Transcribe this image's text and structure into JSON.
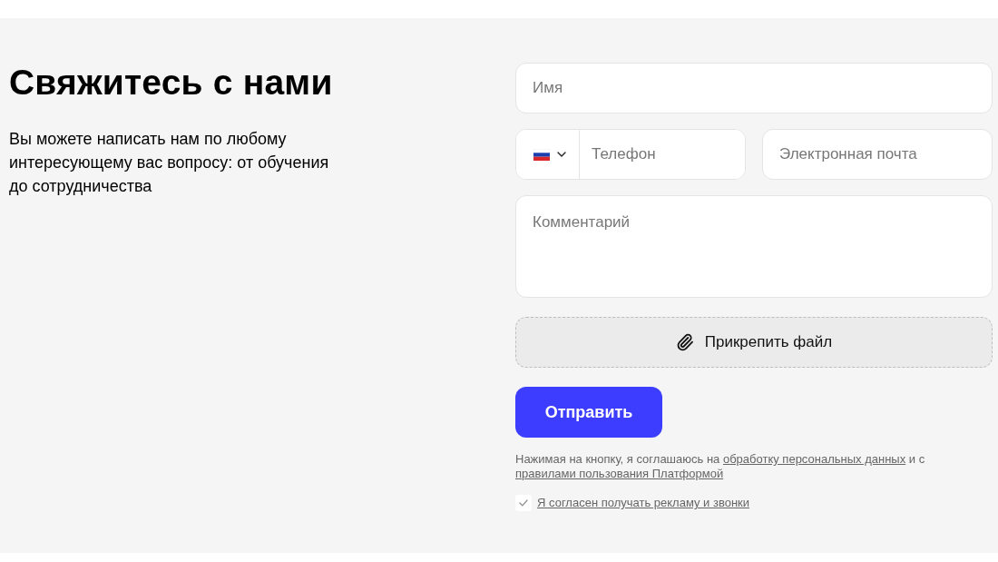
{
  "heading": {
    "title": "Свяжитесь с нами",
    "description": "Вы можете написать нам по любому интересующему вас вопросу: от обучения до сотрудничества"
  },
  "form": {
    "name": {
      "placeholder": "Имя"
    },
    "phone": {
      "placeholder": "Телефон"
    },
    "email": {
      "placeholder": "Электронная почта"
    },
    "comment": {
      "placeholder": "Комментарий"
    },
    "attach_button": {
      "label": "Прикрепить файл"
    },
    "submit_button": {
      "label": "Отправить"
    },
    "agreement": [
      {
        "kind": "text",
        "text": "Нажимая на кнопку, я соглашаюсь на"
      },
      {
        "kind": "link",
        "text": "обработку персональных данных"
      },
      {
        "kind": "text",
        "text": "и с"
      },
      {
        "kind": "link",
        "text": "правилами пользования Платформой"
      }
    ],
    "marketing_consent": {
      "label": "Я согласен получать рекламу и звонки",
      "checked": true
    }
  }
}
